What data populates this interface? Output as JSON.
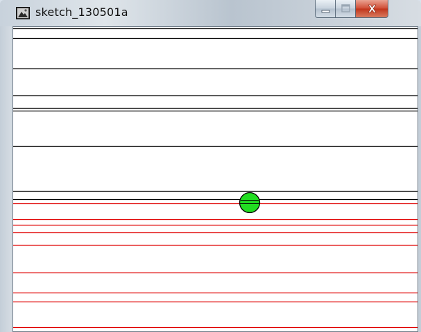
{
  "window": {
    "title": "sketch_130501a",
    "icon": "processing-sketch-icon",
    "buttons": {
      "minimize_icon": "minimize-icon",
      "maximize_icon": "maximize-icon",
      "close_icon": "close-icon",
      "close_glyph": "X"
    }
  },
  "sketch": {
    "line_colors": {
      "upper": "#000000",
      "lower": "#e00000"
    },
    "ball_color": "#22dd22"
  }
}
